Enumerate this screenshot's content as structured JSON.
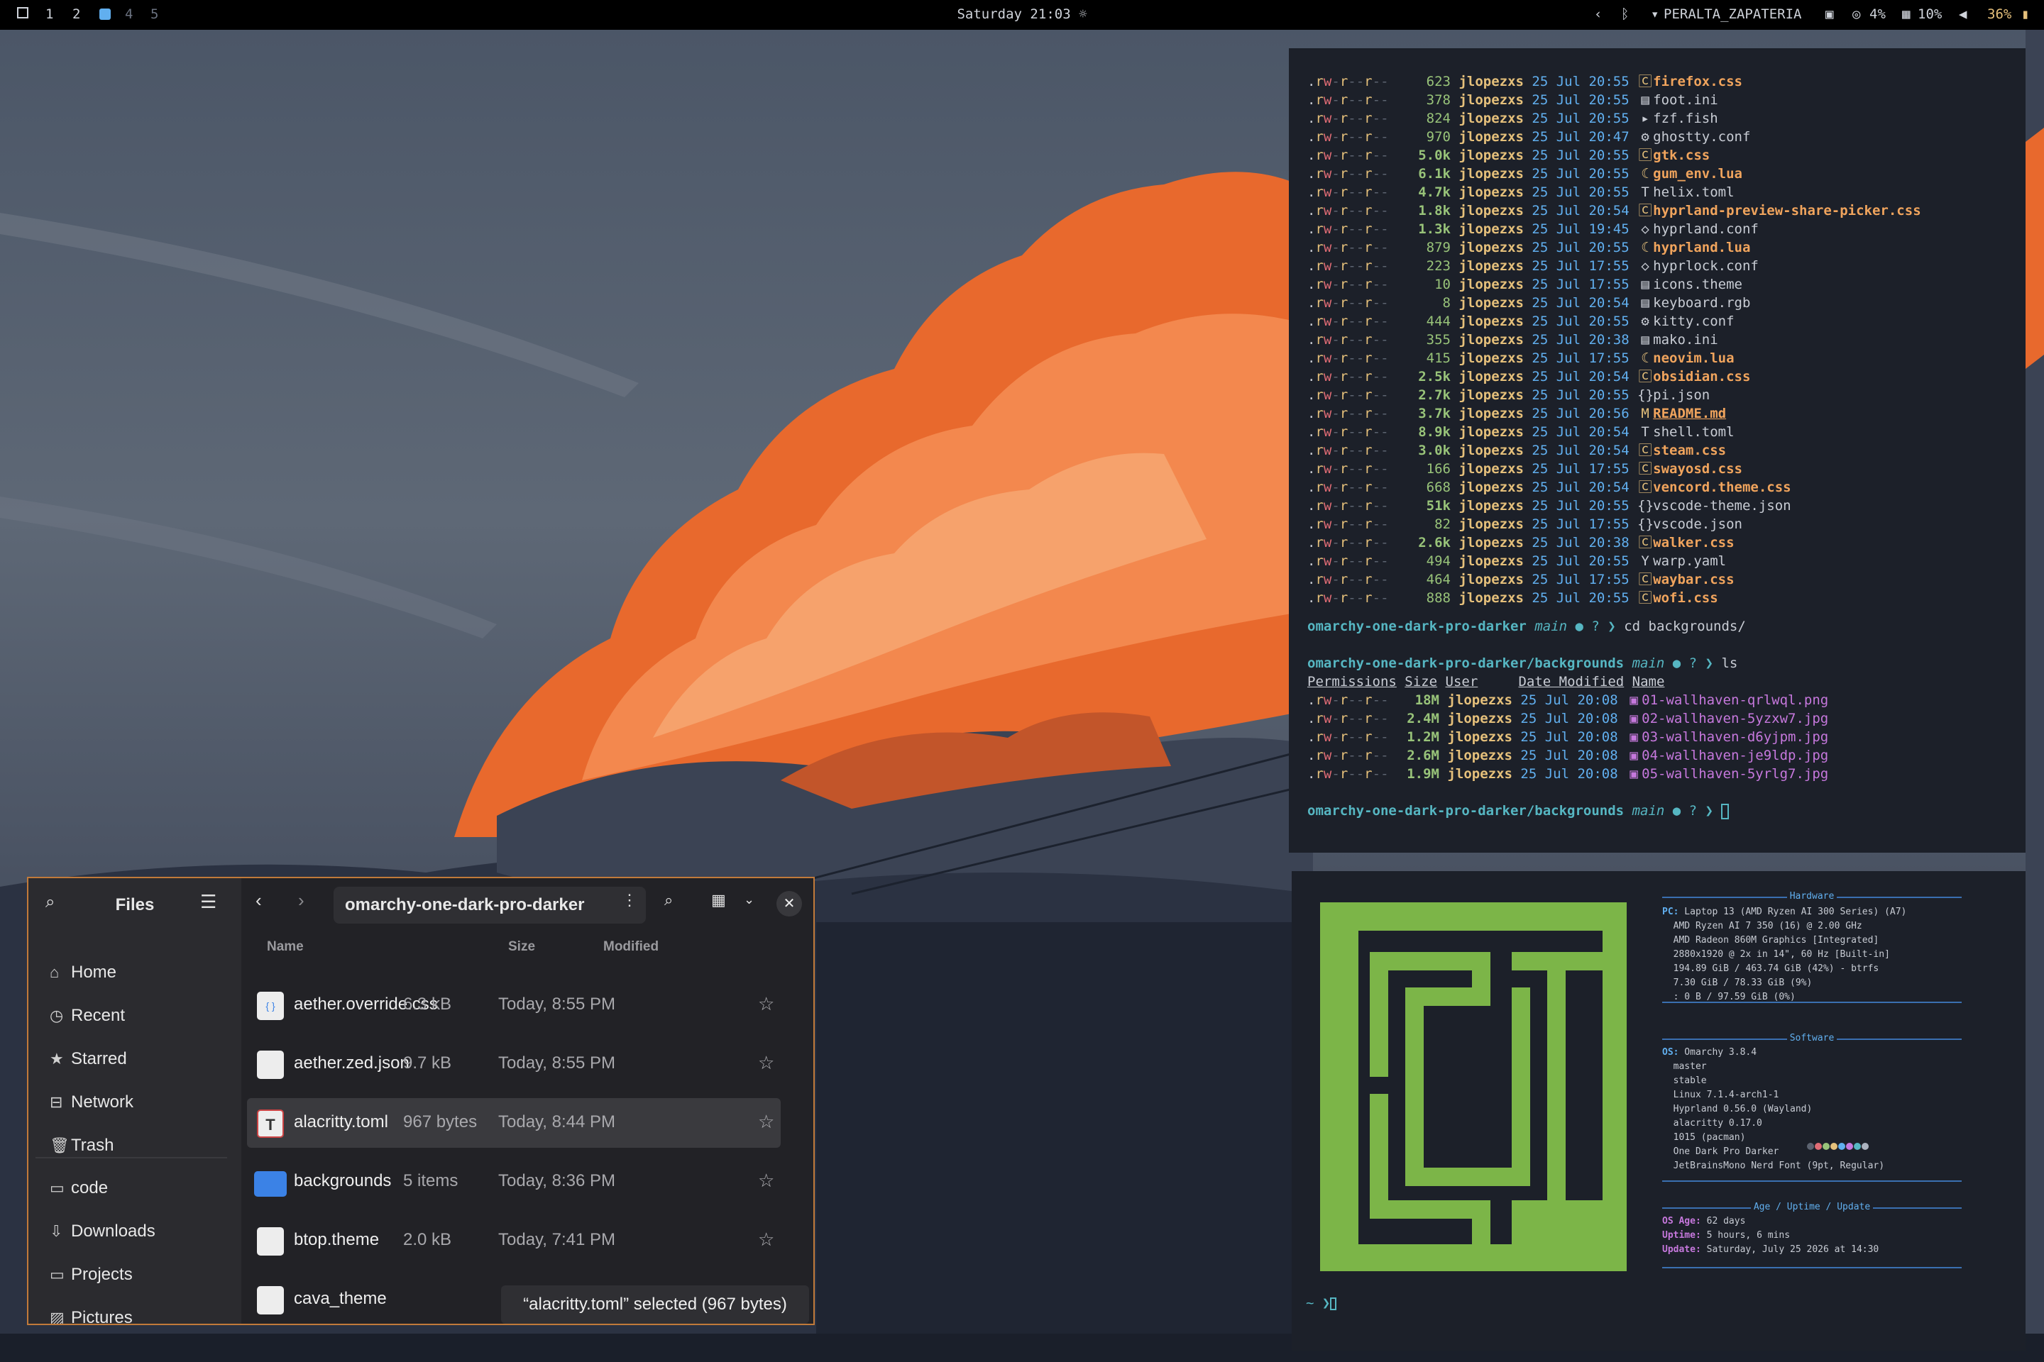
{
  "topbar": {
    "workspaces": [
      "1",
      "2",
      "3",
      "4",
      "5"
    ],
    "active_workspace": "3",
    "clock": "Saturday 21:03 ☼",
    "network": "PERALTA_ZAPATERIA",
    "cpu": "4%",
    "memory": "10%",
    "battery": "36%"
  },
  "term1": {
    "files": [
      {
        "size": "623",
        "date": "25 Jul 20:55",
        "icon": "css",
        "name": "firefox.css",
        "style": "orange"
      },
      {
        "size": "378",
        "date": "25 Jul 20:55",
        "icon": "ini",
        "name": "foot.ini",
        "style": "plain"
      },
      {
        "size": "824",
        "date": "25 Jul 20:55",
        "icon": "term",
        "name": "fzf.fish",
        "style": "plain"
      },
      {
        "size": "970",
        "date": "25 Jul 20:47",
        "icon": "conf",
        "name": "ghostty.conf",
        "style": "plain"
      },
      {
        "size": "5.0k",
        "date": "25 Jul 20:55",
        "icon": "css",
        "name": "gtk.css",
        "style": "orange"
      },
      {
        "size": "6.1k",
        "date": "25 Jul 20:55",
        "icon": "lua",
        "name": "gum_env.lua",
        "style": "orange"
      },
      {
        "size": "4.7k",
        "date": "25 Jul 20:55",
        "icon": "toml",
        "name": "helix.toml",
        "style": "plain"
      },
      {
        "size": "1.8k",
        "date": "25 Jul 20:54",
        "icon": "css",
        "name": "hyprland-preview-share-picker.css",
        "style": "orange"
      },
      {
        "size": "1.3k",
        "date": "25 Jul 19:45",
        "icon": "hypr",
        "name": "hyprland.conf",
        "style": "plain"
      },
      {
        "size": "879",
        "date": "25 Jul 20:55",
        "icon": "lua",
        "name": "hyprland.lua",
        "style": "orange"
      },
      {
        "size": "223",
        "date": "25 Jul 17:55",
        "icon": "hypr",
        "name": "hyprlock.conf",
        "style": "plain"
      },
      {
        "size": "10",
        "date": "25 Jul 17:55",
        "icon": "file",
        "name": "icons.theme",
        "style": "plain"
      },
      {
        "size": "8",
        "date": "25 Jul 20:54",
        "icon": "file",
        "name": "keyboard.rgb",
        "style": "plain"
      },
      {
        "size": "444",
        "date": "25 Jul 20:55",
        "icon": "conf",
        "name": "kitty.conf",
        "style": "plain"
      },
      {
        "size": "355",
        "date": "25 Jul 20:38",
        "icon": "file",
        "name": "mako.ini",
        "style": "plain"
      },
      {
        "size": "415",
        "date": "25 Jul 17:55",
        "icon": "lua",
        "name": "neovim.lua",
        "style": "orange"
      },
      {
        "size": "2.5k",
        "date": "25 Jul 20:54",
        "icon": "css",
        "name": "obsidian.css",
        "style": "orange"
      },
      {
        "size": "2.7k",
        "date": "25 Jul 20:55",
        "icon": "json",
        "name": "pi.json",
        "style": "plain"
      },
      {
        "size": "3.7k",
        "date": "25 Jul 20:56",
        "icon": "md",
        "name": "README.md",
        "style": "link"
      },
      {
        "size": "8.9k",
        "date": "25 Jul 20:54",
        "icon": "toml",
        "name": "shell.toml",
        "style": "plain"
      },
      {
        "size": "3.0k",
        "date": "25 Jul 20:54",
        "icon": "css",
        "name": "steam.css",
        "style": "orange"
      },
      {
        "size": "166",
        "date": "25 Jul 17:55",
        "icon": "css",
        "name": "swayosd.css",
        "style": "orange"
      },
      {
        "size": "668",
        "date": "25 Jul 20:54",
        "icon": "css",
        "name": "vencord.theme.css",
        "style": "orange"
      },
      {
        "size": "51k",
        "date": "25 Jul 20:55",
        "icon": "json",
        "name": "vscode-theme.json",
        "style": "plain"
      },
      {
        "size": "82",
        "date": "25 Jul 17:55",
        "icon": "json",
        "name": "vscode.json",
        "style": "plain"
      },
      {
        "size": "2.6k",
        "date": "25 Jul 20:38",
        "icon": "css",
        "name": "walker.css",
        "style": "orange"
      },
      {
        "size": "494",
        "date": "25 Jul 20:55",
        "icon": "yaml",
        "name": "warp.yaml",
        "style": "plain"
      },
      {
        "size": "464",
        "date": "25 Jul 17:55",
        "icon": "css",
        "name": "waybar.css",
        "style": "orange"
      },
      {
        "size": "888",
        "date": "25 Jul 20:55",
        "icon": "css",
        "name": "wofi.css",
        "style": "orange"
      }
    ],
    "perm": ".rw-r--r--",
    "user": "jlopezxs",
    "prompt1_path": "omarchy-one-dark-pro-darker",
    "prompt1_branch": "main",
    "prompt_status": "● ? ❯",
    "cmd1": "cd backgrounds/",
    "prompt2_path": "omarchy-one-dark-pro-darker/backgrounds",
    "cmd2": "ls",
    "headers": [
      "Permissions",
      "Size",
      "User",
      "Date Modified",
      "Name"
    ],
    "images": [
      {
        "size": "18M",
        "date": "25 Jul 20:08",
        "name": "01-wallhaven-qrlwql.png"
      },
      {
        "size": "2.4M",
        "date": "25 Jul 20:08",
        "name": "02-wallhaven-5yzxw7.jpg"
      },
      {
        "size": "1.2M",
        "date": "25 Jul 20:08",
        "name": "03-wallhaven-d6yjpm.jpg"
      },
      {
        "size": "2.6M",
        "date": "25 Jul 20:08",
        "name": "04-wallhaven-je9ldp.jpg"
      },
      {
        "size": "1.9M",
        "date": "25 Jul 20:08",
        "name": "05-wallhaven-5yrlg7.jpg"
      }
    ]
  },
  "term2": {
    "hardware_title": "Hardware",
    "hardware": [
      {
        "k": "PC:",
        "v": " Laptop 13 (AMD Ryzen AI 300 Series) (A7)"
      },
      {
        "k": "",
        "v": "  AMD Ryzen AI 7 350 (16) @ 2.00 GHz"
      },
      {
        "k": "",
        "v": "  AMD Radeon 860M Graphics [Integrated]"
      },
      {
        "k": "",
        "v": "  2880x1920 @ 2x in 14\", 60 Hz [Built-in]"
      },
      {
        "k": "",
        "v": "  194.89 GiB / 463.74 GiB (42%) - btrfs"
      },
      {
        "k": "",
        "v": "  7.30 GiB / 78.33 GiB (9%)"
      },
      {
        "k": "",
        "v": "  : 0 B / 97.59 GiB (0%)"
      }
    ],
    "software_title": "Software",
    "software": [
      {
        "k": "OS:",
        "v": " Omarchy 3.8.4"
      },
      {
        "k": "",
        "v": "  master"
      },
      {
        "k": "",
        "v": "  stable"
      },
      {
        "k": "",
        "v": "  Linux 7.1.4-arch1-1"
      },
      {
        "k": "",
        "v": "  Hyprland 0.56.0 (Wayland)"
      },
      {
        "k": "",
        "v": "  alacritty 0.17.0"
      },
      {
        "k": "",
        "v": "  1015 (pacman)"
      },
      {
        "k": "",
        "v": "  One Dark Pro Darker"
      },
      {
        "k": "",
        "v": "  JetBrainsMono Nerd Font (9pt, Regular)"
      }
    ],
    "age_title": "Age / Uptime / Update",
    "age": [
      {
        "k": "OS Age:",
        "v": " 62 days"
      },
      {
        "k": "Uptime:",
        "v": " 5 hours, 6 mins"
      },
      {
        "k": "Update:",
        "v": " Saturday, July 25 2026 at 14:30"
      }
    ],
    "palette": [
      "#5c6370",
      "#e06c75",
      "#98c379",
      "#e5c07b",
      "#61afef",
      "#c678dd",
      "#56b6c2",
      "#abb2bf"
    ],
    "prompt": "~ ❯"
  },
  "files": {
    "title": "Files",
    "sidebar": [
      {
        "label": "Home",
        "icon": "home-icon"
      },
      {
        "label": "Recent",
        "icon": "clock-icon"
      },
      {
        "label": "Starred",
        "icon": "star-icon"
      },
      {
        "label": "Network",
        "icon": "network-icon"
      },
      {
        "label": "Trash",
        "icon": "trash-icon"
      }
    ],
    "bookmarks": [
      {
        "label": "code",
        "icon": "folder-icon"
      },
      {
        "label": "Downloads",
        "icon": "download-icon"
      },
      {
        "label": "Projects",
        "icon": "folder-icon"
      },
      {
        "label": "Pictures",
        "icon": "image-icon"
      }
    ],
    "path": "omarchy-one-dark-pro-darker",
    "columns": {
      "name": "Name",
      "size": "Size",
      "modified": "Modified"
    },
    "rows": [
      {
        "name": "aether.override.css",
        "size": "6.3 kB",
        "modified": "Today, 8:55 PM",
        "icon": "code-file-icon"
      },
      {
        "name": "aether.zed.json",
        "size": "9.7 kB",
        "modified": "Today, 8:55 PM",
        "icon": "text-file-icon"
      },
      {
        "name": "alacritty.toml",
        "size": "967 bytes",
        "modified": "Today, 8:44 PM",
        "icon": "toml-file-icon"
      },
      {
        "name": "backgrounds",
        "size": "5 items",
        "modified": "Today, 8:36 PM",
        "icon": "folder-icon"
      },
      {
        "name": "btop.theme",
        "size": "2.0 kB",
        "modified": "Today, 7:41 PM",
        "icon": "text-file-icon"
      },
      {
        "name": "cava_theme",
        "size": "",
        "modified": "",
        "icon": "text-file-icon"
      }
    ],
    "selected_row": 2,
    "status": "“alacritty.toml” selected  (967 bytes)"
  }
}
